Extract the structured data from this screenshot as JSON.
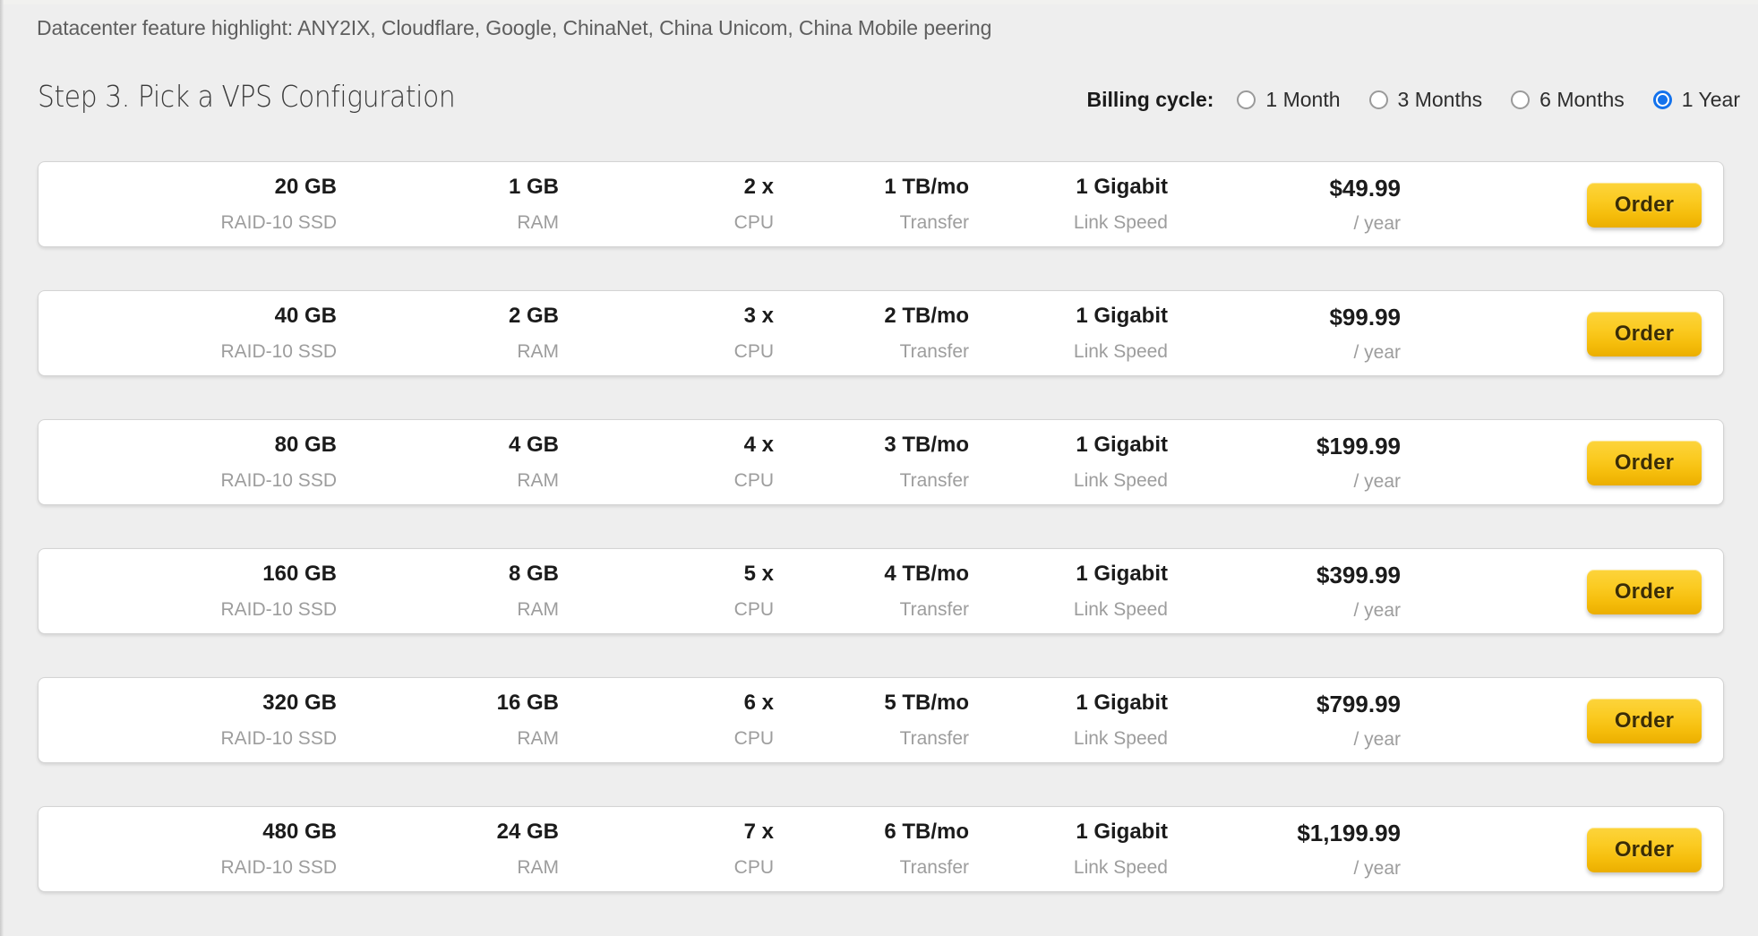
{
  "feature_bar": {
    "text": "Datacenter feature highlight: ANY2IX, Cloudflare, Google, ChinaNet, China Unicom, China Mobile peering"
  },
  "step_header": {
    "title": "Step 3. Pick a VPS Configuration"
  },
  "billing": {
    "label": "Billing cycle:",
    "selected": "1 Year",
    "options": [
      {
        "label": "1 Month",
        "selected": false
      },
      {
        "label": "3 Months",
        "selected": false
      },
      {
        "label": "6 Months",
        "selected": false
      },
      {
        "label": "1 Year",
        "selected": true
      }
    ]
  },
  "column_labels": {
    "disk": "RAID-10 SSD",
    "ram": "RAM",
    "cpu": "CPU",
    "transfer": "Transfer",
    "link": "Link Speed",
    "price_period": "/ year"
  },
  "order_button_label": "Order",
  "plans": [
    {
      "disk": "20 GB",
      "disk_label": "RAID-10 SSD",
      "ram": "1 GB",
      "ram_label": "RAM",
      "cpu": "2 x",
      "cpu_label": "CPU",
      "transfer": "1 TB/mo",
      "transfer_label": "Transfer",
      "link": "1 Gigabit",
      "link_label": "Link Speed",
      "price": "$49.99",
      "price_period": "/ year",
      "order": "Order"
    },
    {
      "disk": "40 GB",
      "disk_label": "RAID-10 SSD",
      "ram": "2 GB",
      "ram_label": "RAM",
      "cpu": "3 x",
      "cpu_label": "CPU",
      "transfer": "2 TB/mo",
      "transfer_label": "Transfer",
      "link": "1 Gigabit",
      "link_label": "Link Speed",
      "price": "$99.99",
      "price_period": "/ year",
      "order": "Order"
    },
    {
      "disk": "80 GB",
      "disk_label": "RAID-10 SSD",
      "ram": "4 GB",
      "ram_label": "RAM",
      "cpu": "4 x",
      "cpu_label": "CPU",
      "transfer": "3 TB/mo",
      "transfer_label": "Transfer",
      "link": "1 Gigabit",
      "link_label": "Link Speed",
      "price": "$199.99",
      "price_period": "/ year",
      "order": "Order"
    },
    {
      "disk": "160 GB",
      "disk_label": "RAID-10 SSD",
      "ram": "8 GB",
      "ram_label": "RAM",
      "cpu": "5 x",
      "cpu_label": "CPU",
      "transfer": "4 TB/mo",
      "transfer_label": "Transfer",
      "link": "1 Gigabit",
      "link_label": "Link Speed",
      "price": "$399.99",
      "price_period": "/ year",
      "order": "Order"
    },
    {
      "disk": "320 GB",
      "disk_label": "RAID-10 SSD",
      "ram": "16 GB",
      "ram_label": "RAM",
      "cpu": "6 x",
      "cpu_label": "CPU",
      "transfer": "5 TB/mo",
      "transfer_label": "Transfer",
      "link": "1 Gigabit",
      "link_label": "Link Speed",
      "price": "$799.99",
      "price_period": "/ year",
      "order": "Order"
    },
    {
      "disk": "480 GB",
      "disk_label": "RAID-10 SSD",
      "ram": "24 GB",
      "ram_label": "RAM",
      "cpu": "7 x",
      "cpu_label": "CPU",
      "transfer": "6 TB/mo",
      "transfer_label": "Transfer",
      "link": "1 Gigabit",
      "link_label": "Link Speed",
      "price": "$1,199.99",
      "price_period": "/ year",
      "order": "Order"
    }
  ],
  "colors": {
    "page_background": "#eeeeee",
    "card_background": "#ffffff",
    "card_border": "#d4d4d4",
    "value_text": "#1b1b1b",
    "label_text": "#9d9d9d",
    "radio_selected": "#1372ec",
    "order_button_top": "#fcd43c",
    "order_button_bottom": "#ebae00",
    "order_button_text": "#3b2d05"
  }
}
